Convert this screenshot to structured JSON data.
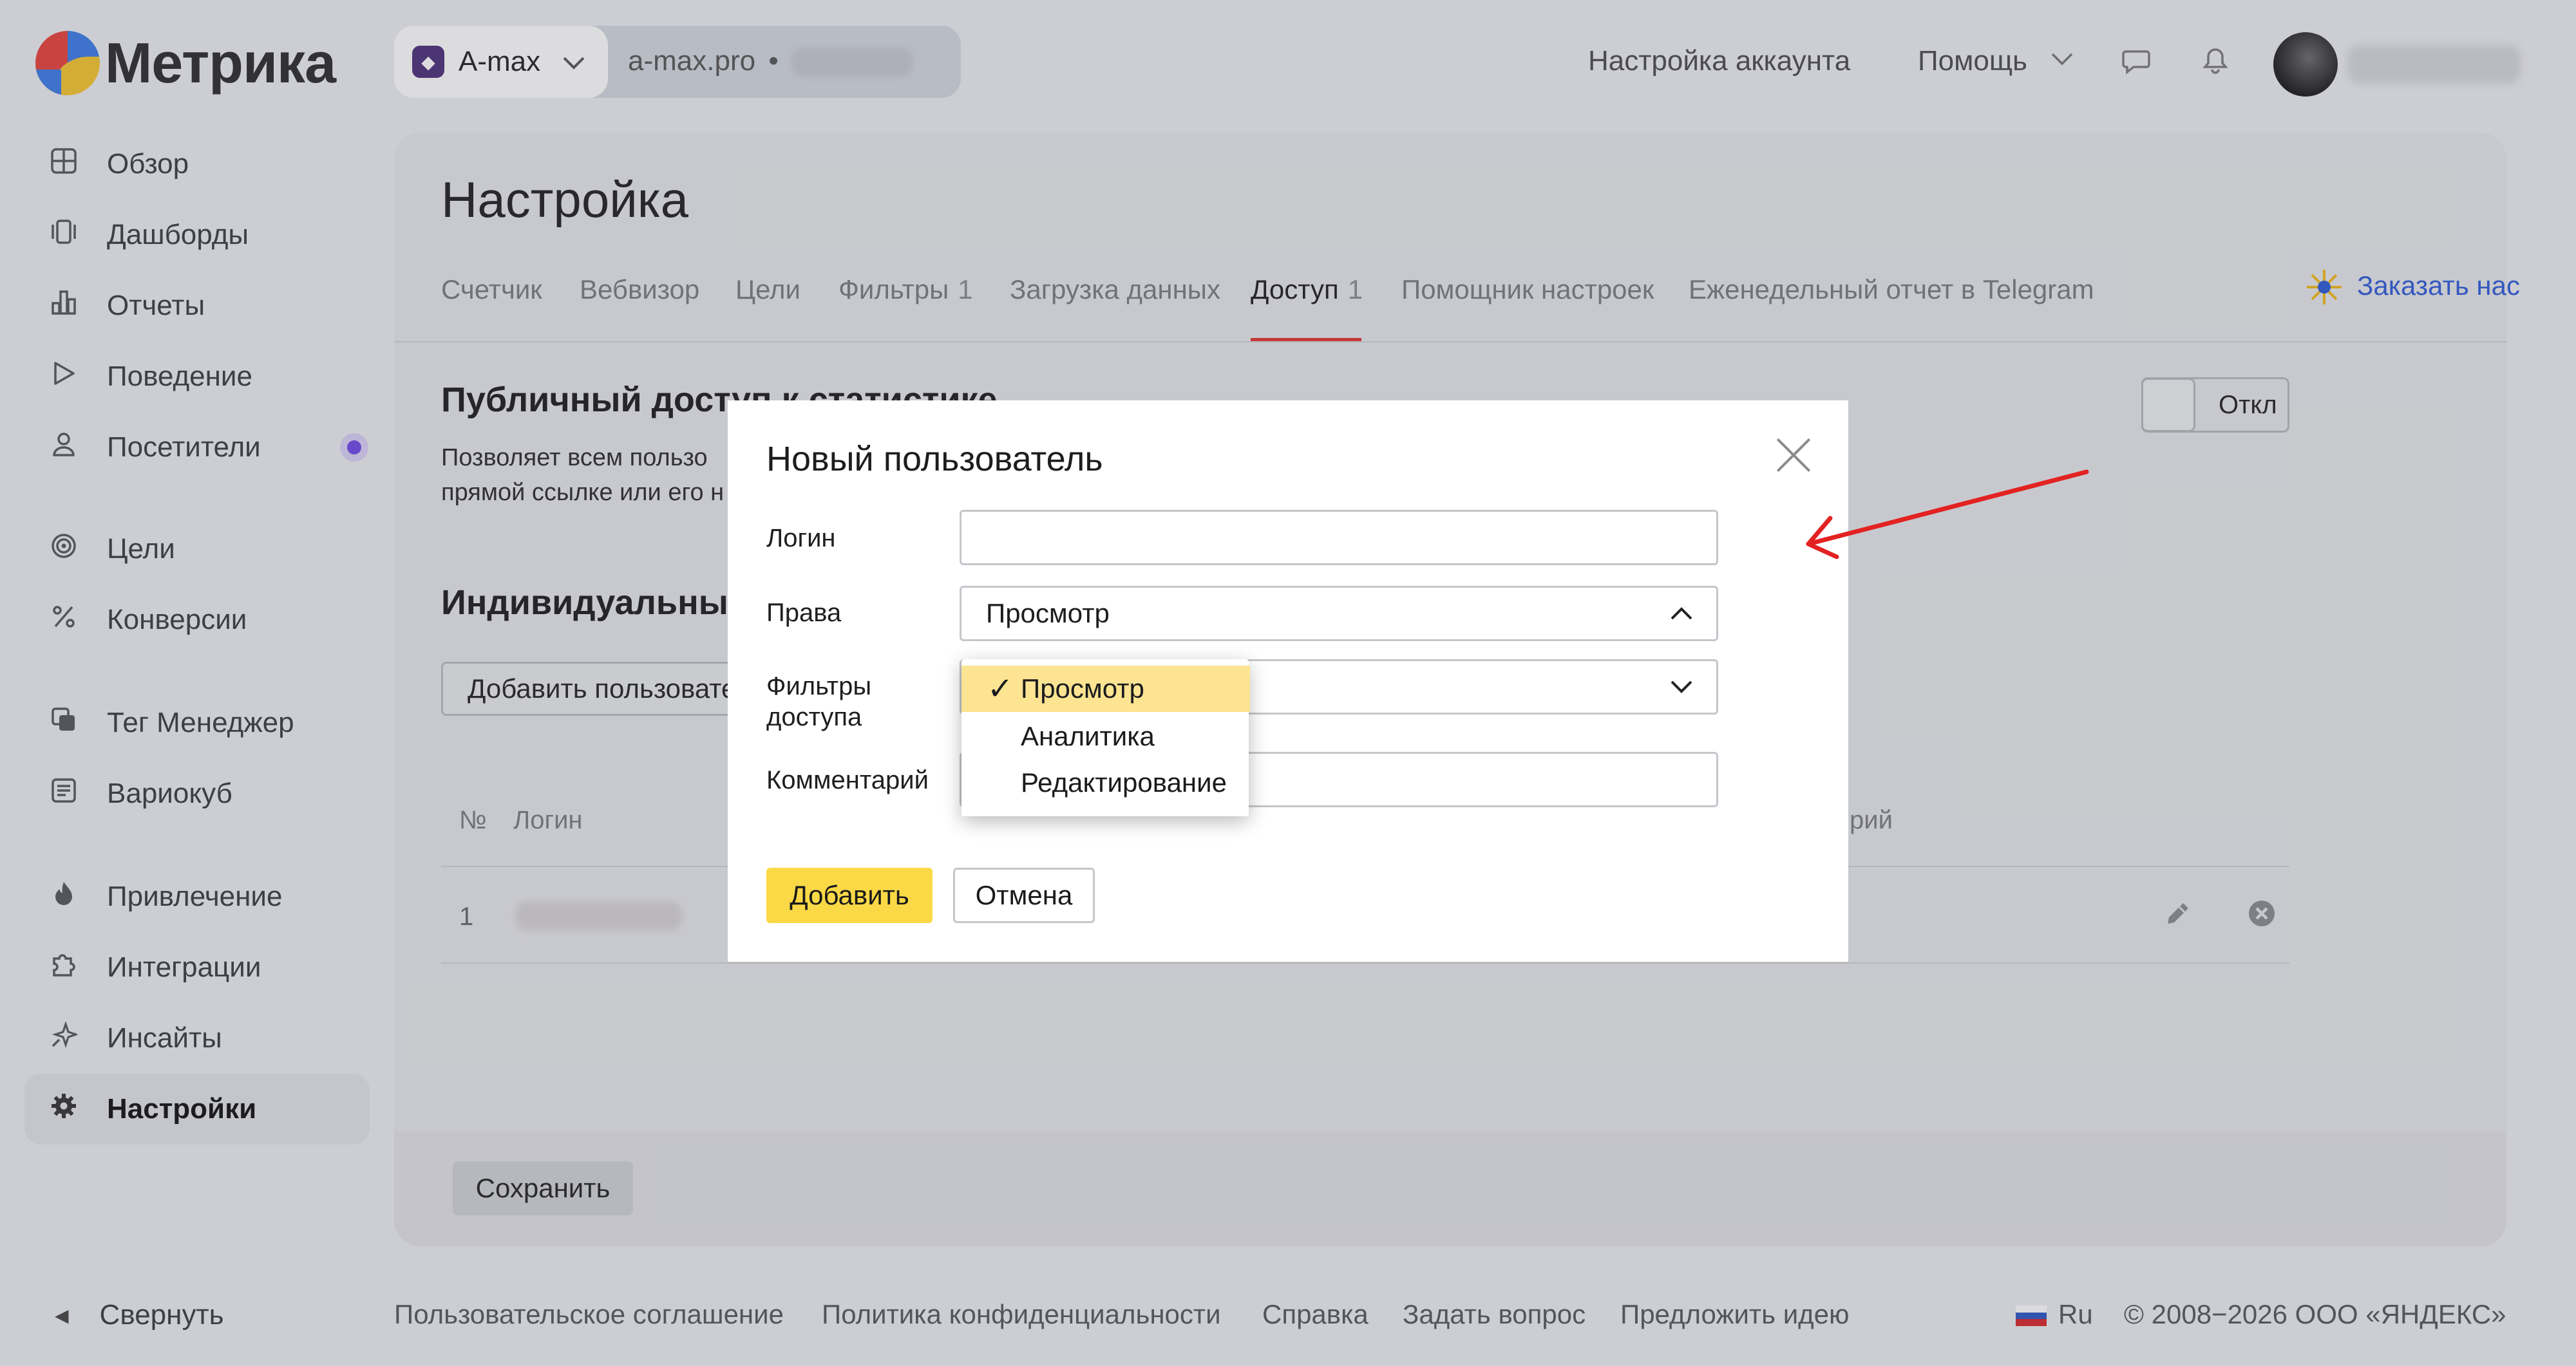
{
  "app": {
    "logo_text": "Метрика",
    "counter": {
      "name": "A-max",
      "site": "a-max.pro",
      "separator": "•",
      "id_hidden": ""
    }
  },
  "header": {
    "account_settings": "Настройка аккаунта",
    "help": "Помощь"
  },
  "sidebar": {
    "items": [
      {
        "label": "Обзор",
        "icon": "grid-icon"
      },
      {
        "label": "Дашборды",
        "icon": "dashboards-icon"
      },
      {
        "label": "Отчеты",
        "icon": "bar-chart-icon"
      },
      {
        "label": "Поведение",
        "icon": "play-icon"
      },
      {
        "label": "Посетители",
        "icon": "user-icon"
      },
      {
        "label": "Цели",
        "icon": "target-icon"
      },
      {
        "label": "Конверсии",
        "icon": "percent-icon"
      },
      {
        "label": "Тег Менеджер",
        "icon": "tag-manager-icon"
      },
      {
        "label": "Вариокуб",
        "icon": "variocube-icon"
      },
      {
        "label": "Привлечение",
        "icon": "flame-icon"
      },
      {
        "label": "Интеграции",
        "icon": "puzzle-icon"
      },
      {
        "label": "Инсайты",
        "icon": "sparkle-icon"
      },
      {
        "label": "Настройки",
        "icon": "gear-icon"
      }
    ],
    "collapse": "Свернуть"
  },
  "main": {
    "title": "Настройка",
    "tabs": [
      {
        "label": "Счетчик",
        "count": ""
      },
      {
        "label": "Вебвизор",
        "count": ""
      },
      {
        "label": "Цели",
        "count": ""
      },
      {
        "label": "Фильтры",
        "count": "1"
      },
      {
        "label": "Загрузка данных",
        "count": ""
      },
      {
        "label": "Доступ",
        "count": "1"
      },
      {
        "label": "Помощник настроек",
        "count": ""
      },
      {
        "label": "Еженедельный отчет в Telegram",
        "count": ""
      }
    ],
    "order_link": "Заказать нас",
    "public_access": {
      "title": "Публичный доступ к статистике",
      "text_line1": "Позволяет всем пользо",
      "text_line2": "прямой ссылке или его н",
      "toggle": "Откл"
    },
    "individual": {
      "title": "Индивидуальный",
      "add_button": "Добавить пользовате"
    },
    "table": {
      "headers": [
        "№",
        "Логин",
        "рий"
      ],
      "rows": [
        {
          "num": "1",
          "login": ""
        }
      ]
    },
    "save_button": "Сохранить"
  },
  "modal": {
    "title": "Новый пользователь",
    "labels": {
      "login": "Логин",
      "rights": "Права",
      "filters_line1": "Фильтры",
      "filters_line2": "доступа",
      "comment": "Комментарий"
    },
    "login_value": "",
    "rights_value": "Просмотр",
    "dropdown_options": [
      "Просмотр",
      "Аналитика",
      "Редактирование"
    ],
    "selected_option": "Просмотр",
    "check_mark": "✓",
    "add_button": "Добавить",
    "cancel_button": "Отмена"
  },
  "footer": {
    "links": [
      "Пользовательское соглашение",
      "Политика конфиденциальности",
      "Справка",
      "Задать вопрос",
      "Предложить идею"
    ],
    "lang": "Ru",
    "copyright": "© 2008−2026 ООО «ЯНДЕКС»"
  },
  "colors": {
    "accent_yellow": "#fbd946",
    "dropdown_selected": "#fce492",
    "tab_underline": "#e03232",
    "annotation_arrow": "#e32222",
    "link_blue": "#2c5bd8"
  }
}
